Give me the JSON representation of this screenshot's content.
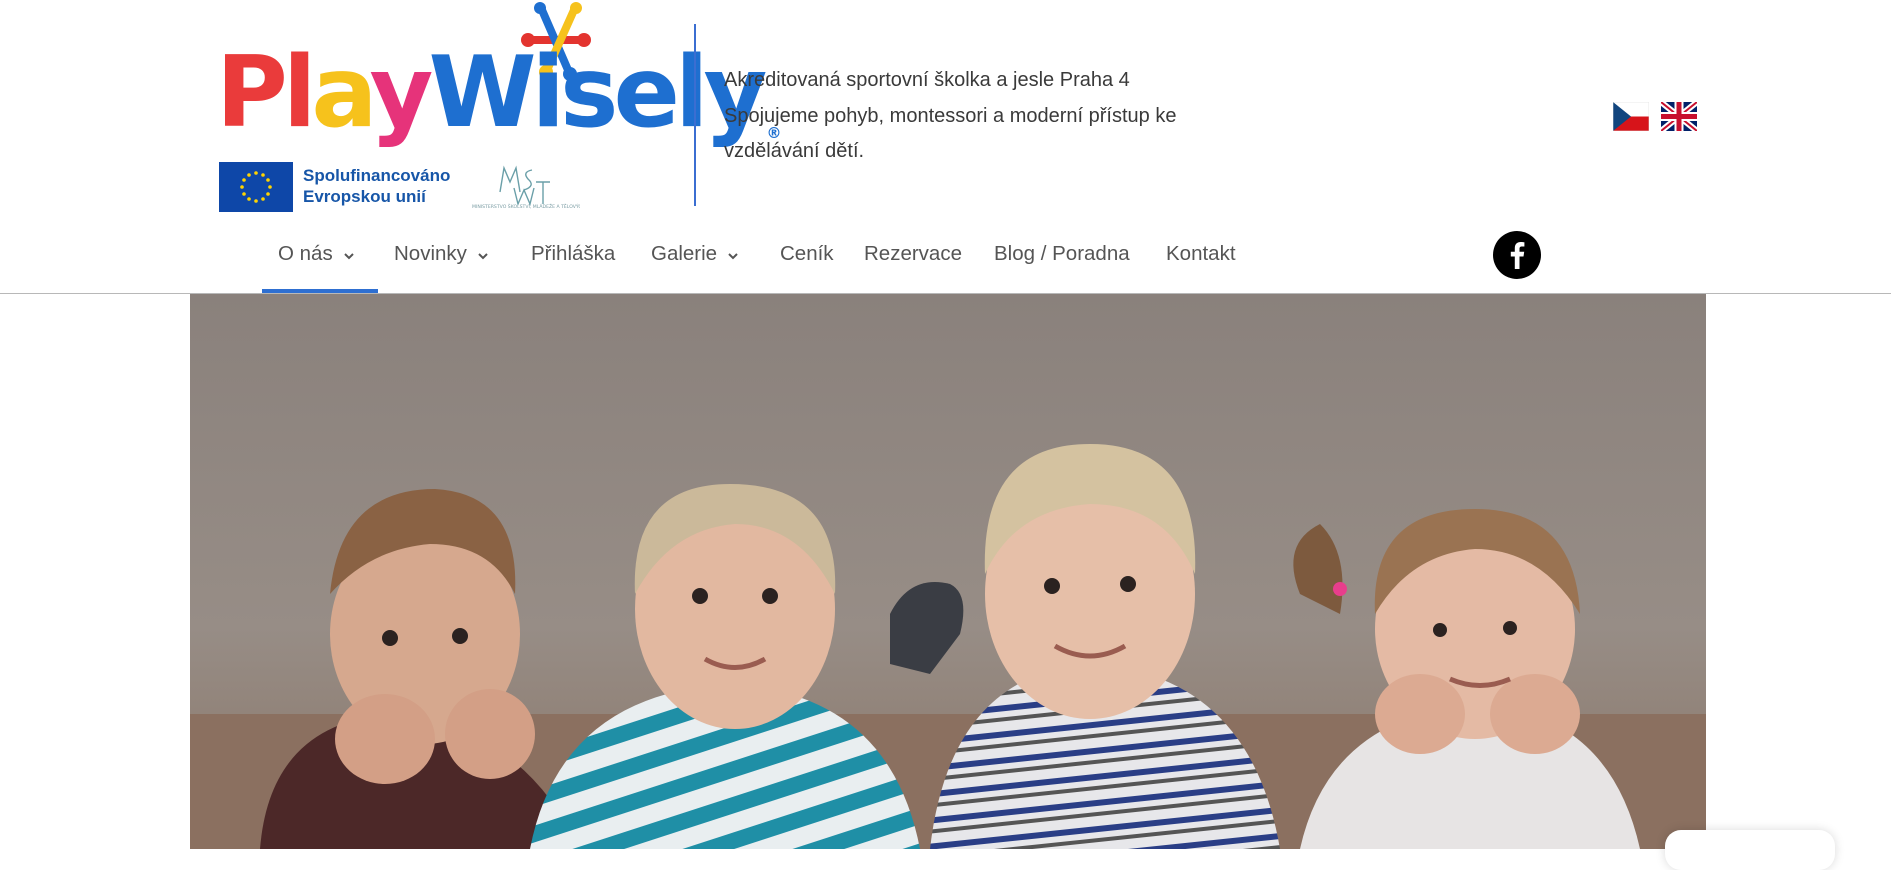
{
  "brand": {
    "logo_word": [
      "P",
      "l",
      "a",
      "y",
      "W",
      "i",
      "s",
      "e",
      "l",
      "y"
    ],
    "registered": "®",
    "eu_caption": "Spolufinancováno\nEvropskou unií",
    "msmt_caption": "MINISTERSTVO ŠKOLSTVÍ, MLÁDEŽE A TĚLOVÝCHOVY"
  },
  "tagline": {
    "line1": "Akreditovaná sportovní školka a jesle Praha 4",
    "line2": "Spojujeme pohyb, montessori a moderní přístup ke vzdělávání dětí."
  },
  "languages": [
    {
      "code": "cs",
      "icon": "czech-flag-icon"
    },
    {
      "code": "en",
      "icon": "uk-flag-icon"
    }
  ],
  "nav": {
    "items": [
      {
        "label": "O nás",
        "has_dropdown": true,
        "active": true
      },
      {
        "label": "Novinky",
        "has_dropdown": true
      },
      {
        "label": "Přihláška",
        "has_dropdown": false
      },
      {
        "label": "Galerie",
        "has_dropdown": true
      },
      {
        "label": "Ceník",
        "has_dropdown": false
      },
      {
        "label": "Rezervace",
        "has_dropdown": false
      },
      {
        "label": "Blog / Poradna",
        "has_dropdown": false
      },
      {
        "label": "Kontakt",
        "has_dropdown": false
      }
    ]
  },
  "social": {
    "icon": "facebook-icon"
  },
  "colors": {
    "accent_blue": "#2e6fd1",
    "logo_red": "#ea3b3b",
    "logo_yellow": "#f6c21c",
    "logo_pink": "#e6337a",
    "logo_blue": "#1e6fd0",
    "eu_blue": "#0e47a8"
  },
  "hero": {
    "image": "four-children-lying-on-floor-photo"
  }
}
